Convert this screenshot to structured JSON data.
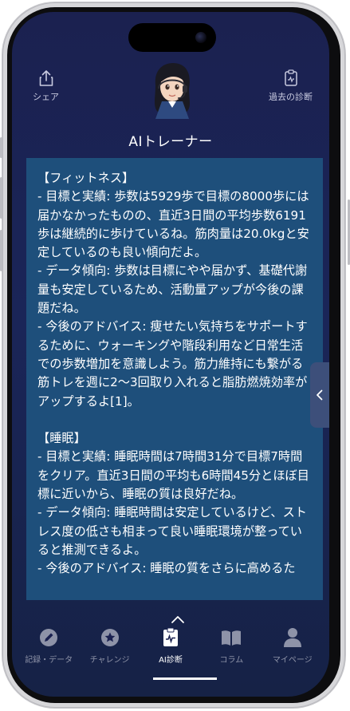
{
  "header": {
    "share_label": "シェア",
    "past_diagnosis_label": "過去の診断",
    "trainer_name": "AIトレーナー",
    "avatar_icon": "trainer-avatar-headset"
  },
  "message": {
    "text": "【フィットネス】\n- 目標と実績: 歩数は5929歩で目標の8000歩には届かなかったものの、直近3日間の平均歩数6191歩は継続的に歩けているね。筋肉量は20.0kgと安定しているのも良い傾向だよ。\n- データ傾向: 歩数は目標にやや届かず、基礎代謝量も安定しているため、活動量アップが今後の課題だね。\n- 今後のアドバイス: 痩せたい気持ちをサポートするために、ウォーキングや階段利用など日常生活での歩数増加を意識しよう。筋力維持にも繋がる筋トレを週に2〜3回取り入れると脂肪燃焼効率がアップするよ[1]。\n\n【睡眠】\n- 目標と実績: 睡眠時間は7時間31分で目標7時間をクリア。直近3日間の平均も6時間45分とほぼ目標に近いから、睡眠の質は良好だね。\n- データ傾向: 睡眠時間は安定しているけど、ストレス度の低さも相まって良い睡眠環境が整っていると推測できるよ。\n- 今後のアドバイス: 睡眠の質をさらに高めるた"
  },
  "tabbar": {
    "tabs": [
      {
        "label": "記録・データ",
        "icon": "pencil-icon"
      },
      {
        "label": "チャレンジ",
        "icon": "star-icon"
      },
      {
        "label": "AI診断",
        "icon": "ai-diagnosis-icon"
      },
      {
        "label": "コラム",
        "icon": "book-icon"
      },
      {
        "label": "マイページ",
        "icon": "person-icon"
      }
    ],
    "active_index": 2
  },
  "colors": {
    "background_top": "#1b2150",
    "message_bubble": "#1e4f7b",
    "tab_inactive": "#8e93a8",
    "tab_active": "#ffffff"
  }
}
